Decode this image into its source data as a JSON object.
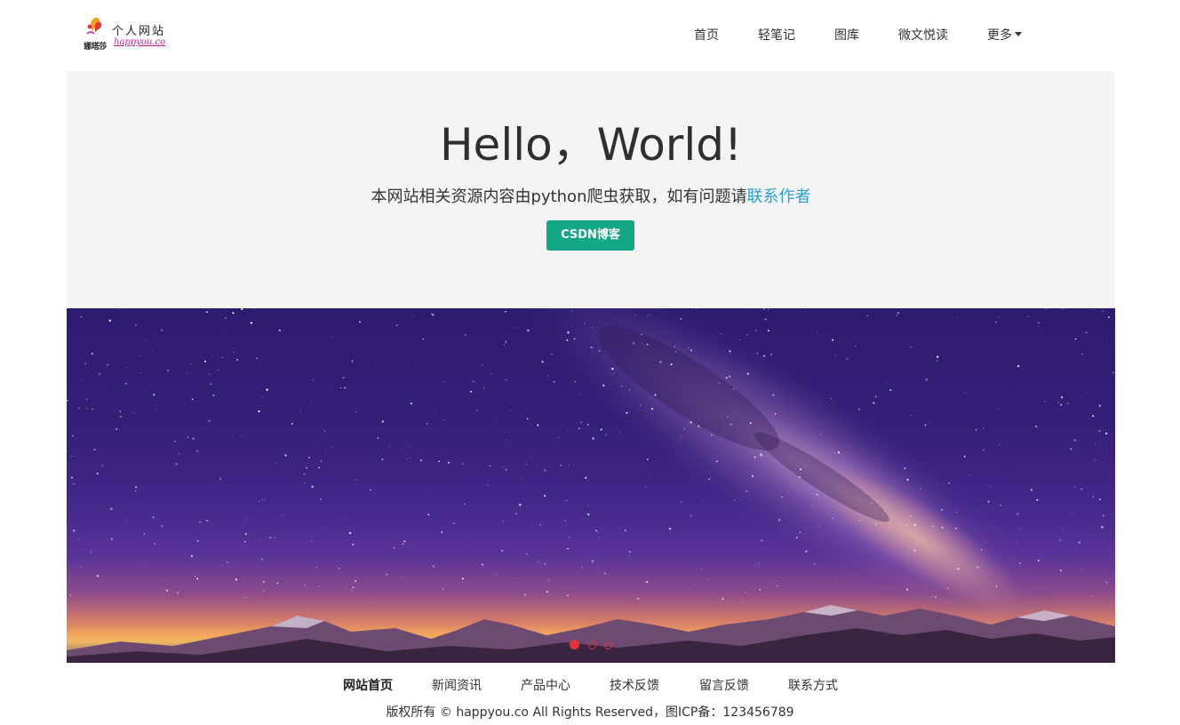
{
  "brand": {
    "logo_text": "娜塔莎",
    "title": "个人网站",
    "subtitle": "happyou.co"
  },
  "nav": {
    "items": [
      "首页",
      "轻笔记",
      "图库",
      "微文悦读"
    ],
    "more_label": "更多"
  },
  "hero": {
    "title": "Hello，World!",
    "lead_text": "本网站相关资源内容由python爬虫获取，如有问题请",
    "lead_link": "联系作者",
    "button_label": "CSDN博客"
  },
  "carousel": {
    "slide_count": 3,
    "active_index": 0
  },
  "footer": {
    "links": [
      "网站首页",
      "新闻资讯",
      "产品中心",
      "技术反馈",
      "留言反馈",
      "联系方式"
    ],
    "copyright": "版权所有 © happyou.co All Rights Reserved，图ICP备：123456789"
  },
  "colors": {
    "accent_button": "#12a785",
    "link": "#2a9fd6",
    "indicator": "#e8323a",
    "jumbotron_bg": "#f4f4f4"
  }
}
